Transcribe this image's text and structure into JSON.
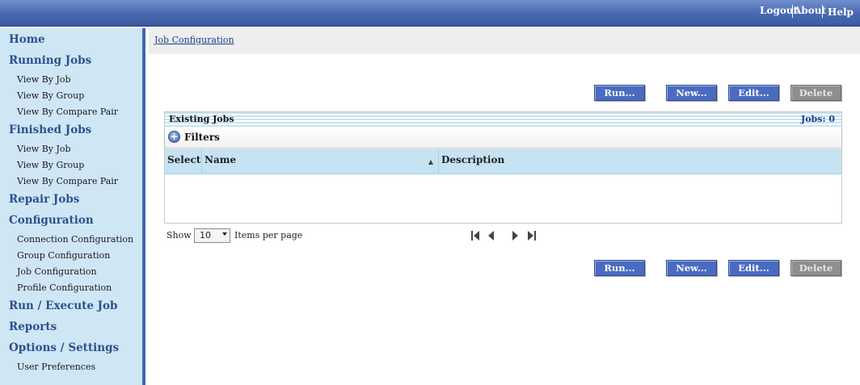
{
  "header": {
    "logout": "Logout",
    "about": "About",
    "help": "Help"
  },
  "sidebar": {
    "home": "Home",
    "running_jobs": {
      "label": "Running Jobs",
      "items": [
        "View By Job",
        "View By Group",
        "View By Compare Pair"
      ]
    },
    "finished_jobs": {
      "label": "Finished Jobs",
      "items": [
        "View By Job",
        "View By Group",
        "View By Compare Pair"
      ]
    },
    "repair_jobs": "Repair Jobs",
    "configuration": {
      "label": "Configuration",
      "items": [
        "Connection Configuration",
        "Group Configuration",
        "Job Configuration",
        "Profile Configuration"
      ]
    },
    "run_execute": "Run / Execute Job",
    "reports": "Reports",
    "options": {
      "label": "Options / Settings",
      "items": [
        "User Preferences"
      ]
    }
  },
  "breadcrumb": "Job Configuration",
  "toolbar": {
    "run": "Run...",
    "new": "New...",
    "edit": "Edit...",
    "delete": "Delete"
  },
  "panel": {
    "title": "Existing Jobs",
    "count": "Jobs: 0",
    "filters": "Filters",
    "columns": [
      "Select",
      "Name",
      "Description"
    ]
  },
  "pagination": {
    "show": "Show",
    "page_size": "10",
    "items_per_page": "Items per page"
  },
  "colors": {
    "accent": "#4a6bc0",
    "sidebar_bg": "#cfe6f5",
    "header_bg": "#4868b0",
    "disabled": "#8e8e8e"
  }
}
